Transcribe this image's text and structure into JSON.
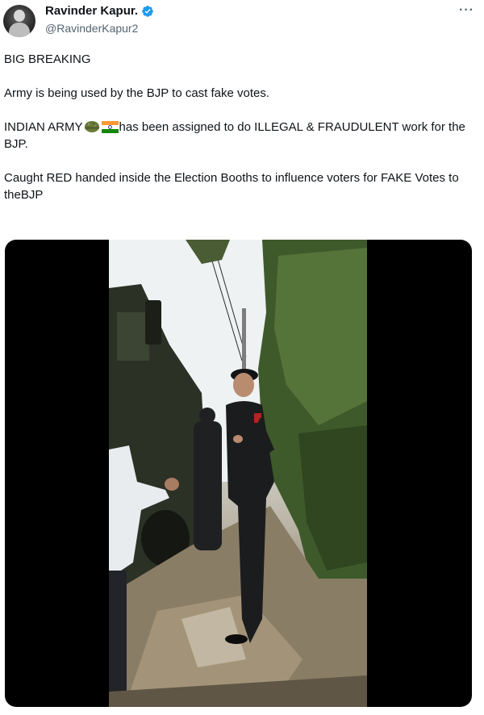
{
  "author": {
    "display_name": "Ravinder Kapur.",
    "handle": "@RavinderKapur2",
    "verified": true,
    "avatar_icon": "profile-photo"
  },
  "menu_icon": "more-options-icon",
  "tweet": {
    "paragraphs": [
      {
        "text": "BIG BREAKING"
      },
      {
        "text": "Army is being used by the BJP to cast fake votes."
      },
      {
        "before": "INDIAN ARMY",
        "emojis": [
          "army-helmet-emoji",
          "india-flag-emoji"
        ],
        "after": "has been assigned to do ILLEGAL & FRAUDULENT work for the BJP."
      },
      {
        "text": "Caught RED handed inside the Election Booths to influence voters for FAKE Votes to theBJP"
      }
    ]
  },
  "media": {
    "type": "video",
    "description_icon": "video-frame"
  },
  "colors": {
    "text": "#0f1419",
    "secondary_text": "#536471",
    "verified_blue": "#1d9bf0",
    "media_background": "#000000"
  }
}
